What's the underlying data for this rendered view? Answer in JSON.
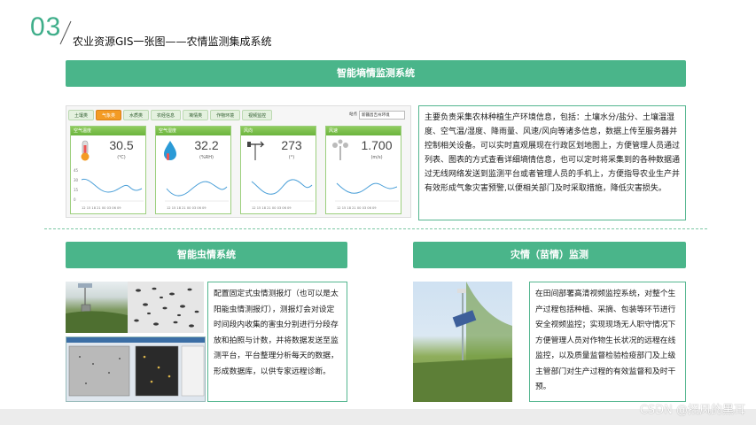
{
  "header": {
    "number": "03",
    "title": "农业资源GIS一张图——农情监测集成系统"
  },
  "sections": {
    "soil": {
      "title": "智能墒情监测系统",
      "description": "主要负责采集农林种植生产环境信息，包括：土壤水分/盐分、土壤温湿度、空气温/湿度、降雨量、风速/风向等诸多信息，数据上传至服务器并控制相关设备。可以实时直观展现在行政区划地图上，方便管理人员通过列表、图表的方式查看详细墒情信息，也可以定时将采集到的各种数据通过无线网络发送到监测平台或者管理人员的手机上，方便指导农业生产并有效形成气象灾害预警,以便相关部门及时采取措施，降低灾害损失。"
    },
    "pest": {
      "title": "智能虫情系统",
      "description": "配置固定式虫情测报灯（也可以是太阳能虫情测报灯），测报灯会对设定时间段内收集的害虫分别进行分段存放和拍照与计数，并将数据发送至监测平台，平台整理分析每天的数据，形成数据库，以供专家远程诊断。"
    },
    "disaster": {
      "title": "灾情（苗情）监测",
      "description": "在田间部署高清视频监控系统，对整个生产过程包括种植、采摘、包装等环节进行安全视频监控；实现现场无人职守情况下方便管理人员对作物生长状况的远程在线监控，以及质量监督检验检疫部门及上级主管部门对生产过程的有效监督和及时干预。"
    }
  },
  "dashboard": {
    "tabs": [
      "土壤类",
      "气象类",
      "水质类",
      "农经信息",
      "墒情类",
      "作物环境",
      "视频监控"
    ],
    "active_tab": 1,
    "select_label": "站点",
    "select_value": "新疆昌吉州环境",
    "cards": [
      {
        "label": "空气温度",
        "value": "30.5",
        "unit": "(℃)",
        "icon": "thermometer-icon"
      },
      {
        "label": "空气湿度",
        "value": "32.2",
        "unit": "(%RH)",
        "icon": "humidity-drop-icon"
      },
      {
        "label": "风向",
        "value": "273",
        "unit": "(°)",
        "icon": "wind-vane-icon"
      },
      {
        "label": "风速",
        "value": "1.700",
        "unit": "(m/s)",
        "icon": "anemometer-icon"
      }
    ],
    "chart_ticks_y": [
      "45",
      "30",
      "15",
      "0"
    ],
    "chart_ticks_x": "12 15 18 21 00 03 06 09"
  },
  "watermark": "CSDN @招风的黑耳",
  "colors": {
    "accent": "#4ab58a",
    "number": "#3fae8a"
  }
}
